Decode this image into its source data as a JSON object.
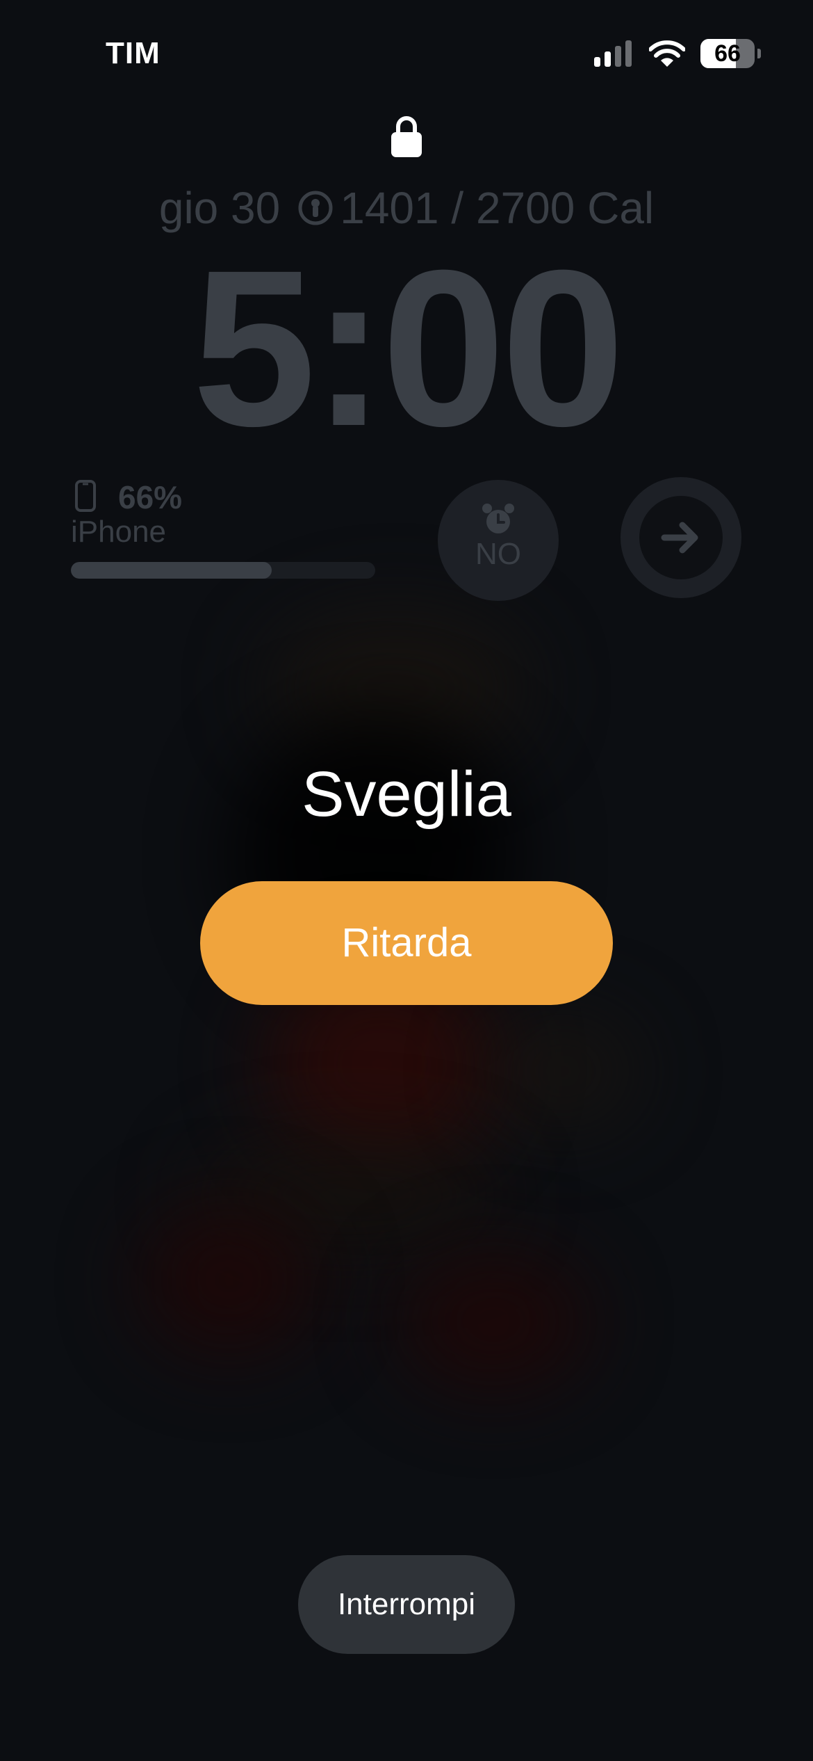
{
  "status_bar": {
    "carrier": "TIM",
    "battery_level": "66",
    "battery_fraction": 0.66,
    "signal_bars_active": 2,
    "signal_bars_total": 4
  },
  "lock_screen": {
    "date": "gio 30",
    "calories": "1401 / 2700 Cal",
    "time": "5:00"
  },
  "widgets": {
    "battery": {
      "percent": "66%",
      "device": "iPhone",
      "level": 0.66
    },
    "alarm": {
      "label": "NO"
    },
    "shortcut": {
      "icon": "arrow-right-icon"
    }
  },
  "alarm": {
    "title": "Sveglia",
    "snooze_label": "Ritarda",
    "stop_label": "Interrompi"
  },
  "colors": {
    "snooze": "#f0a43d",
    "stop": "#2f3338",
    "dim_text": "#3a3f46"
  }
}
